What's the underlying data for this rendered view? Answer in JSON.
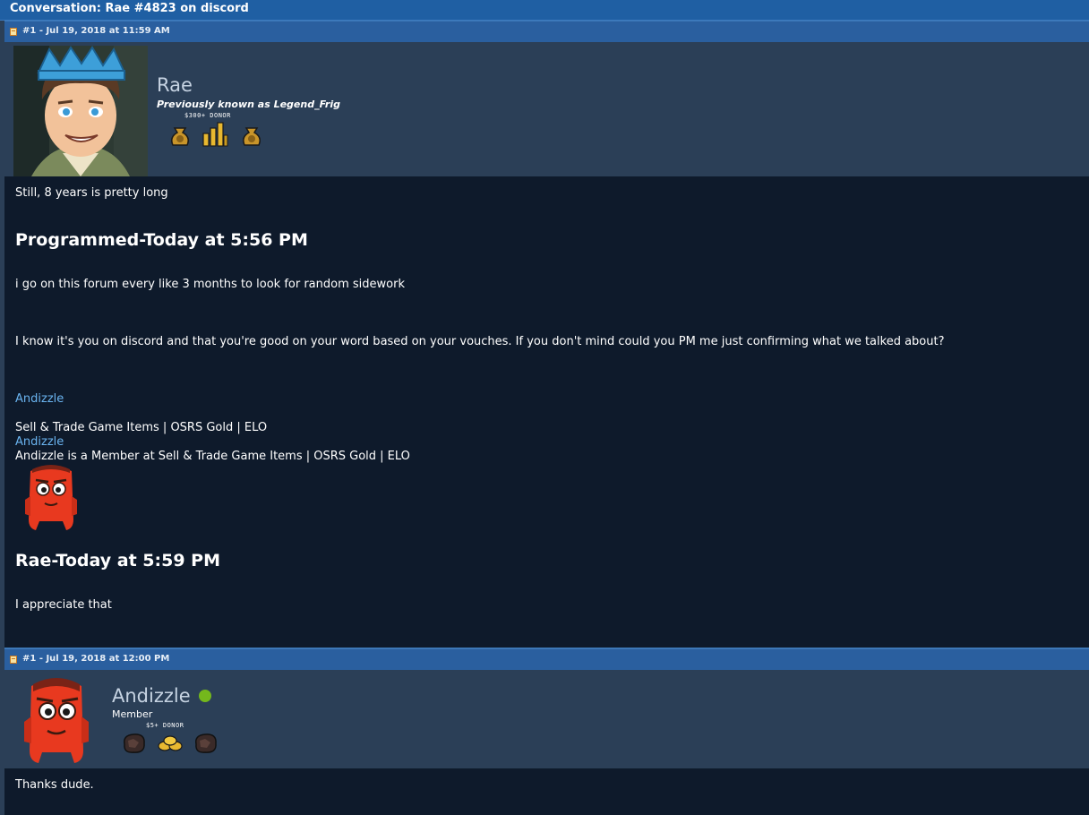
{
  "window": {
    "title": "Conversation: Rae #4823 on discord"
  },
  "post1": {
    "meta": "#1 - Jul 19, 2018 at 11:59 AM",
    "username": "Rae",
    "user_title": "Previously known as Legend_Frig",
    "donor_label": "$300+ DONOR",
    "avatar": "avatar-illustration-crowned-man",
    "badges": [
      "gold-sack-icon",
      "gold-coins-stack-icon",
      "gold-sack-icon"
    ],
    "body": {
      "line1": "Still, 8 years is pretty long",
      "heading1": "Programmed-Today at 5:56 PM",
      "line2": "i go on this forum every like 3 months to look for random sidework",
      "line3": "I know it's you on discord and that you're good on your word based on your vouches. If you don't mind could you PM me just confirming what we talked about?",
      "link1": "Andizzle",
      "line4": "Sell & Trade Game Items | OSRS Gold | ELO",
      "link2": "Andizzle",
      "line5": "Andizzle is a Member at Sell & Trade Game Items | OSRS Gold | ELO",
      "heading2": "Rae-Today at 5:59 PM",
      "line6": "I appreciate that"
    }
  },
  "post2": {
    "meta": "#1 - Jul 19, 2018 at 12:00 PM",
    "username": "Andizzle",
    "user_title": "Member",
    "donor_label": "$5+ DONOR",
    "status": "online",
    "badges": [
      "dark-ore-icon",
      "gold-coins-icon",
      "dark-ore-icon"
    ],
    "body": {
      "line1": "Thanks dude."
    }
  },
  "colors": {
    "title_bar": "#1f5fa3",
    "post_header": "#2a5f9f",
    "user_panel": "#2b3f57",
    "content_bg": "#0e1a2b",
    "link": "#6ab4f0",
    "online": "#74b81c",
    "mascot_red": "#e8391f"
  }
}
